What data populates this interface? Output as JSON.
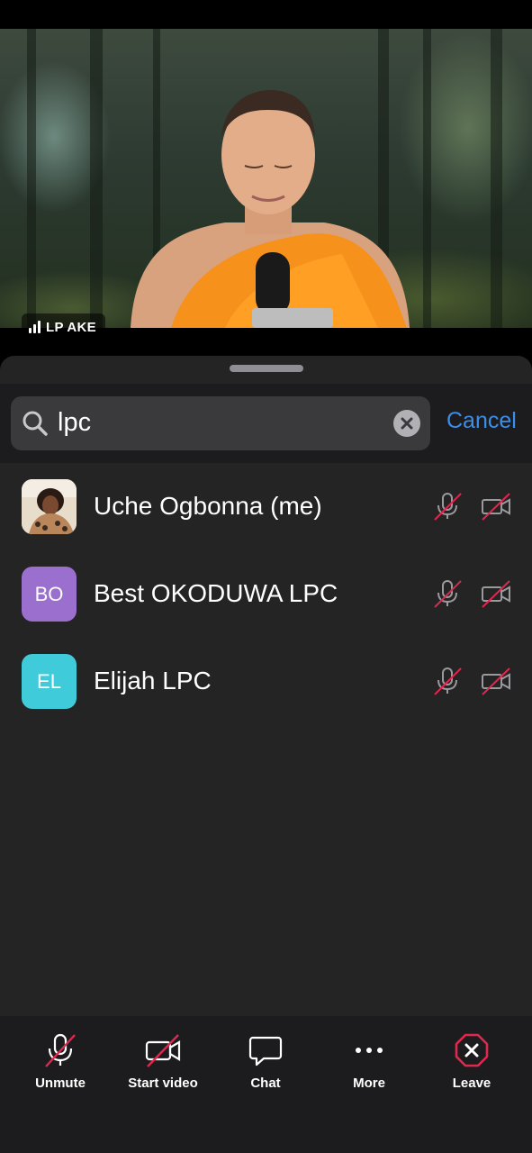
{
  "video": {
    "speaker_name": "LP AKE",
    "signal_icon": "signal-bars-icon"
  },
  "search": {
    "value": "lpc",
    "cancel_label": "Cancel"
  },
  "participants": [
    {
      "name": "Uche Ogbonna (me)",
      "initials": "",
      "avatar_color": "#c9a27a",
      "muted": true,
      "video_off": true
    },
    {
      "name": "Best OKODUWA LPC",
      "initials": "BO",
      "avatar_color": "#9a6fce",
      "muted": true,
      "video_off": true
    },
    {
      "name": "Elijah LPC",
      "initials": "EL",
      "avatar_color": "#3fcbd9",
      "muted": true,
      "video_off": true
    }
  ],
  "toolbar": {
    "unmute_label": "Unmute",
    "start_video_label": "Start video",
    "chat_label": "Chat",
    "more_label": "More",
    "leave_label": "Leave"
  },
  "colors": {
    "accent": "#3b8eea",
    "muted_slash": "#e0284e",
    "leave": "#e0284e"
  }
}
